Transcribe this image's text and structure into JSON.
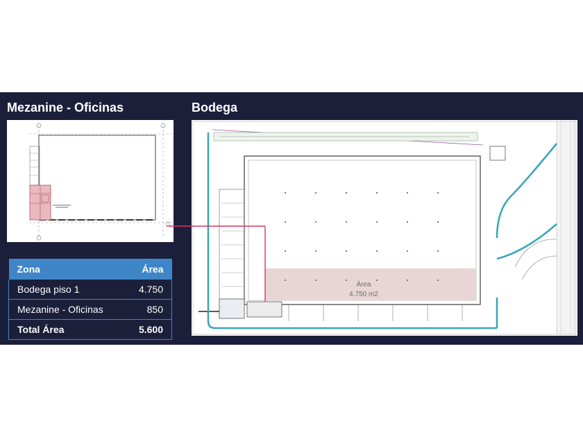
{
  "titles": {
    "mezanine": "Mezanine - Oficinas",
    "bodega": "Bodega"
  },
  "plan_labels": {
    "area_main": "Área",
    "area_value": "4.750  m2"
  },
  "table": {
    "headers": [
      "Zona",
      "Área"
    ],
    "rows": [
      {
        "zona": "Bodega piso 1",
        "area": "4.750"
      },
      {
        "zona": "Mezanine - Oficinas",
        "area": "850"
      }
    ],
    "total": {
      "zona": "Total Área",
      "area": "5.600"
    }
  },
  "colors": {
    "panel_bg": "#1b1f3a",
    "table_header": "#3f86c8",
    "connector": "#d9365e",
    "road": "#3aa7b5",
    "highlight_area": "#e8d6d6"
  }
}
